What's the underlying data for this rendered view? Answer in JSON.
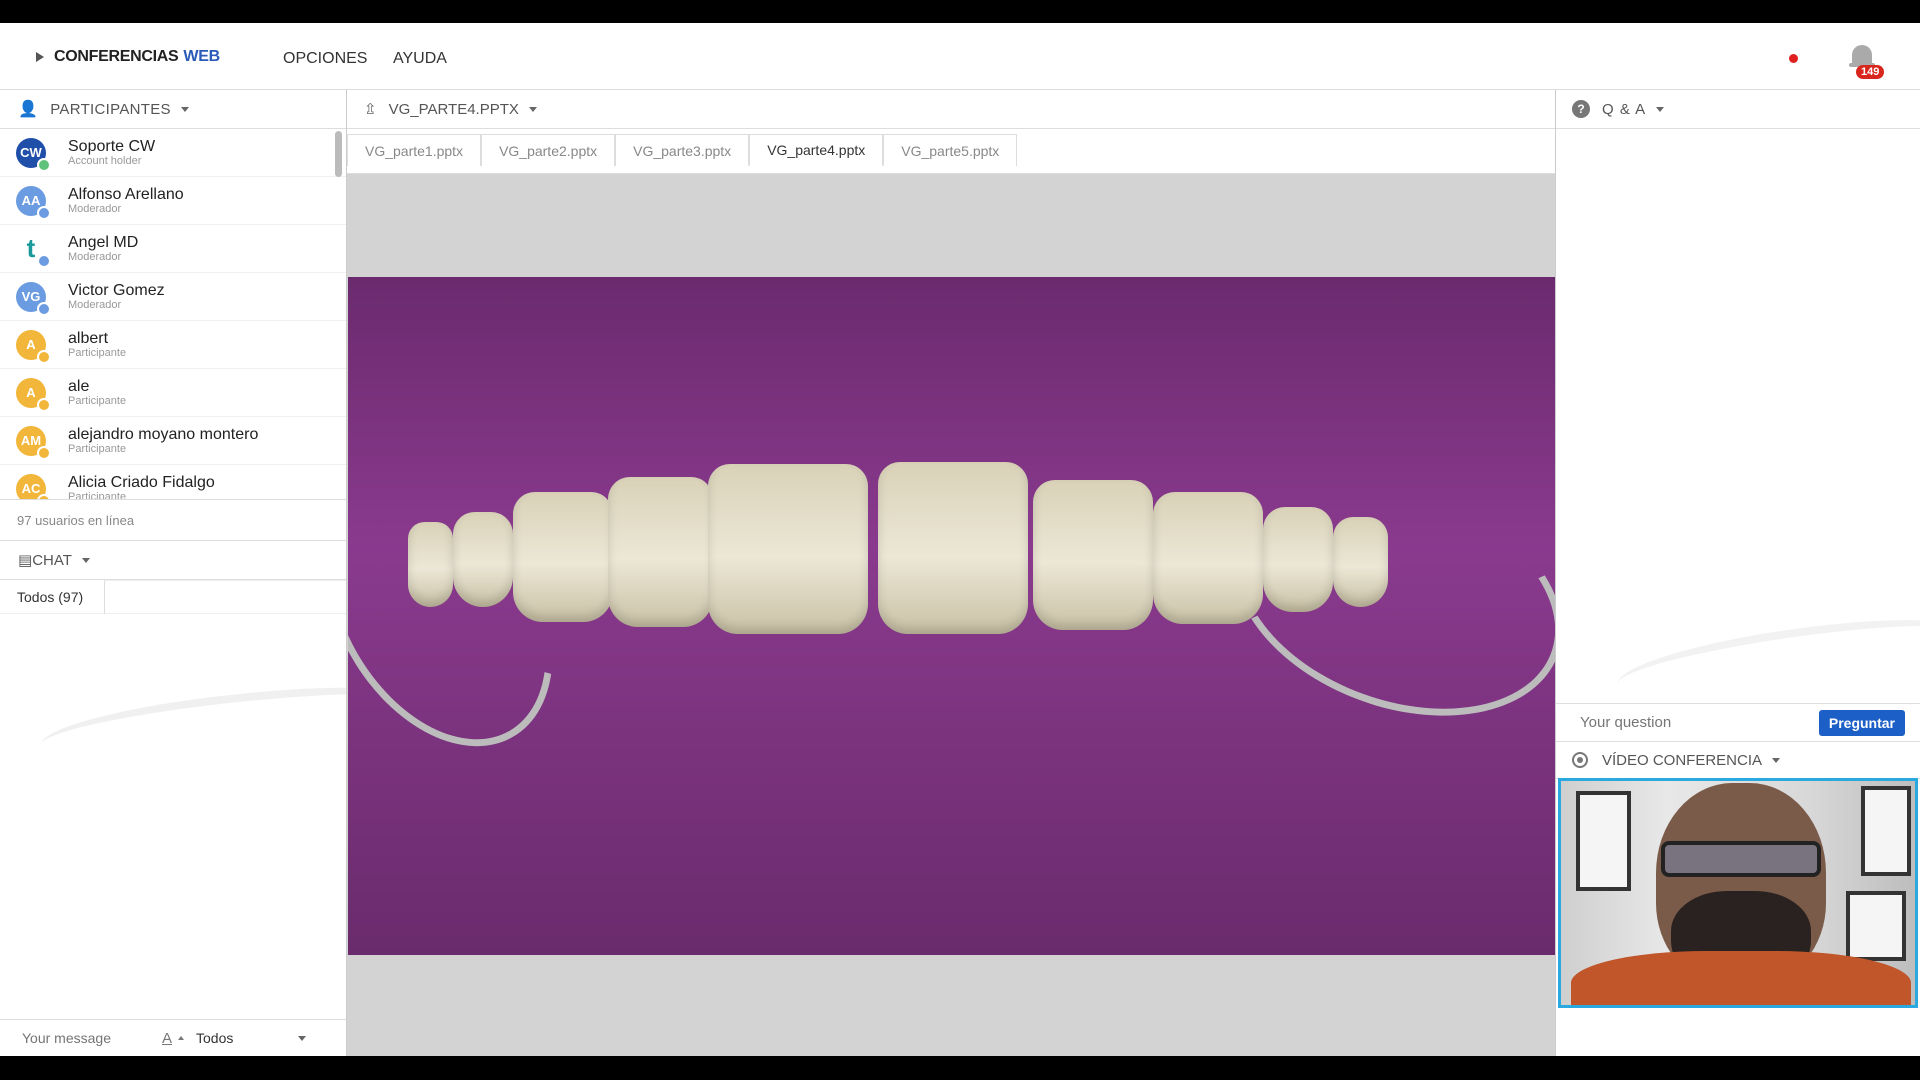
{
  "app": {
    "logo_main": "CONFERENCIAS",
    "logo_accent": "WEB",
    "menu": [
      "OPCIONES",
      "AYUDA"
    ],
    "notification_count": "149"
  },
  "participants_panel": {
    "title": "PARTICIPANTES",
    "online_text": "97 usuarios en línea",
    "items": [
      {
        "initials": "CW",
        "name": "Soporte CW",
        "role": "Account holder",
        "color": "#1f4fa8",
        "sub_color": "#5fc27a"
      },
      {
        "initials": "AA",
        "name": "Alfonso Arellano",
        "role": "Moderador",
        "color": "#6b9be0",
        "sub_color": "#6b9be0"
      },
      {
        "initials": "t",
        "name": "Angel MD",
        "role": "Moderador",
        "color": "#ffffff",
        "sub_color": "#6b9be0"
      },
      {
        "initials": "VG",
        "name": "Victor Gomez",
        "role": "Moderador",
        "color": "#6b9be0",
        "sub_color": "#6b9be0"
      },
      {
        "initials": "A",
        "name": "albert",
        "role": "Participante",
        "color": "#f2b63a",
        "sub_color": "#f2b63a"
      },
      {
        "initials": "A",
        "name": "ale",
        "role": "Participante",
        "color": "#f2b63a",
        "sub_color": "#f2b63a"
      },
      {
        "initials": "AM",
        "name": "alejandro moyano montero",
        "role": "Participante",
        "color": "#f2b63a",
        "sub_color": "#f2b63a"
      },
      {
        "initials": "AC",
        "name": "Alicia Criado Fidalgo",
        "role": "Participante",
        "color": "#f2b63a",
        "sub_color": "#f2b63a"
      }
    ]
  },
  "chat_panel": {
    "title": "CHAT",
    "tab_label": "Todos (97)",
    "input_placeholder": "Your message",
    "font_button": "A",
    "recipient": "Todos"
  },
  "presentation": {
    "title": "VG_PARTE4.PPTX",
    "tabs": [
      {
        "label": "VG_parte1.pptx",
        "active": false
      },
      {
        "label": "VG_parte2.pptx",
        "active": false
      },
      {
        "label": "VG_parte3.pptx",
        "active": false
      },
      {
        "label": "VG_parte4.pptx",
        "active": true
      },
      {
        "label": "VG_parte5.pptx",
        "active": false
      }
    ]
  },
  "qa_panel": {
    "title": "Q & A",
    "input_placeholder": "Your question",
    "ask_button": "Preguntar"
  },
  "video_panel": {
    "title": "VÍDEO CONFERENCIA"
  },
  "colors": {
    "brand_blue": "#2a5bb8",
    "button_blue": "#1c5fc7",
    "recording_red": "#e02020",
    "badge_red": "#d9261c",
    "video_border": "#2aa8e0",
    "slide_purple": "#7a2e7c"
  }
}
